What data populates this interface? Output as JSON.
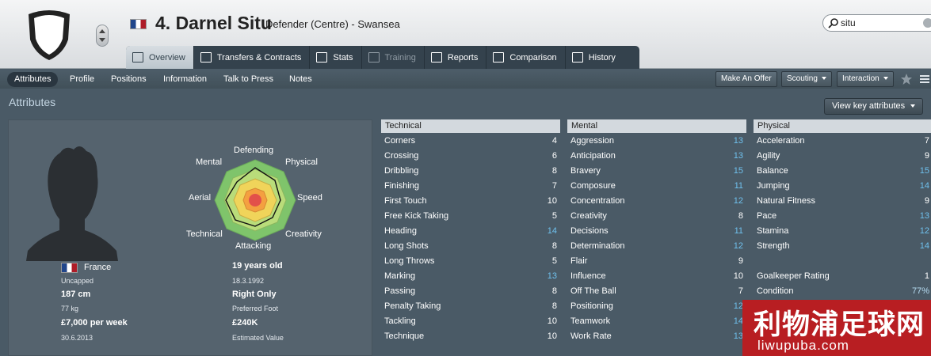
{
  "header": {
    "player_name": "4. Darnel Situ",
    "player_role": "Defender (Centre) - Swansea",
    "search_value": "situ"
  },
  "tabs": [
    {
      "label": "Overview",
      "icon": "profile-card-icon"
    },
    {
      "label": "Transfers & Contracts",
      "icon": "document-icon"
    },
    {
      "label": "Stats",
      "icon": "bar-chart-icon"
    },
    {
      "label": "Training",
      "icon": "whistle-icon"
    },
    {
      "label": "Reports",
      "icon": "notepad-icon"
    },
    {
      "label": "Comparison",
      "icon": "compare-icon"
    },
    {
      "label": "History",
      "icon": "book-icon"
    }
  ],
  "subtabs": [
    "Attributes",
    "Profile",
    "Positions",
    "Information",
    "Talk to Press",
    "Notes"
  ],
  "actions": {
    "make_offer": "Make An Offer",
    "scouting": "Scouting",
    "interaction": "Interaction",
    "view_key": "View key attributes"
  },
  "section_title": "Attributes",
  "profile": {
    "nationality": "France",
    "caps": "Uncapped",
    "height": "187 cm",
    "weight": "77 kg",
    "wage": "£7,000 per week",
    "contract_end": "30.6.2013",
    "age": "19 years old",
    "dob": "18.3.1992",
    "foot": "Right Only",
    "foot_label": "Preferred Foot",
    "value": "£240K",
    "value_label": "Estimated Value"
  },
  "radar_labels": {
    "defending": "Defending",
    "physical": "Physical",
    "speed": "Speed",
    "creativity": "Creativity",
    "attacking": "Attacking",
    "technical": "Technical",
    "aerial": "Aerial",
    "mental": "Mental"
  },
  "columns": {
    "technical": {
      "title": "Technical",
      "rows": [
        {
          "name": "Corners",
          "value": "4"
        },
        {
          "name": "Crossing",
          "value": "6"
        },
        {
          "name": "Dribbling",
          "value": "8"
        },
        {
          "name": "Finishing",
          "value": "7"
        },
        {
          "name": "First Touch",
          "value": "10"
        },
        {
          "name": "Free Kick Taking",
          "value": "5"
        },
        {
          "name": "Heading",
          "value": "14"
        },
        {
          "name": "Long Shots",
          "value": "8"
        },
        {
          "name": "Long Throws",
          "value": "5"
        },
        {
          "name": "Marking",
          "value": "13"
        },
        {
          "name": "Passing",
          "value": "8"
        },
        {
          "name": "Penalty Taking",
          "value": "8"
        },
        {
          "name": "Tackling",
          "value": "10"
        },
        {
          "name": "Technique",
          "value": "10"
        }
      ]
    },
    "mental": {
      "title": "Mental",
      "rows": [
        {
          "name": "Aggression",
          "value": "13"
        },
        {
          "name": "Anticipation",
          "value": "13"
        },
        {
          "name": "Bravery",
          "value": "15"
        },
        {
          "name": "Composure",
          "value": "11"
        },
        {
          "name": "Concentration",
          "value": "12"
        },
        {
          "name": "Creativity",
          "value": "8"
        },
        {
          "name": "Decisions",
          "value": "11"
        },
        {
          "name": "Determination",
          "value": "12"
        },
        {
          "name": "Flair",
          "value": "9"
        },
        {
          "name": "Influence",
          "value": "10"
        },
        {
          "name": "Off The Ball",
          "value": "7"
        },
        {
          "name": "Positioning",
          "value": "12"
        },
        {
          "name": "Teamwork",
          "value": "14"
        },
        {
          "name": "Work Rate",
          "value": "13"
        }
      ]
    },
    "physical": {
      "title": "Physical",
      "rows": [
        {
          "name": "Acceleration",
          "value": "7"
        },
        {
          "name": "Agility",
          "value": "9"
        },
        {
          "name": "Balance",
          "value": "15"
        },
        {
          "name": "Jumping",
          "value": "14"
        },
        {
          "name": "Natural Fitness",
          "value": "9"
        },
        {
          "name": "Pace",
          "value": "13"
        },
        {
          "name": "Stamina",
          "value": "12"
        },
        {
          "name": "Strength",
          "value": "14"
        },
        {
          "name": "",
          "value": ""
        },
        {
          "name": "Goalkeeper Rating",
          "value": "1"
        },
        {
          "name": "Condition",
          "value": "77%"
        }
      ]
    }
  },
  "watermark": {
    "text_cn": "利物浦足球网",
    "url": "liwupuba.com"
  },
  "colors": {
    "value_white": "#ffffff",
    "value_blue": "#6fc1ee",
    "header_bg": "#d9dcdf",
    "panel_bg": "#4a5a66"
  }
}
